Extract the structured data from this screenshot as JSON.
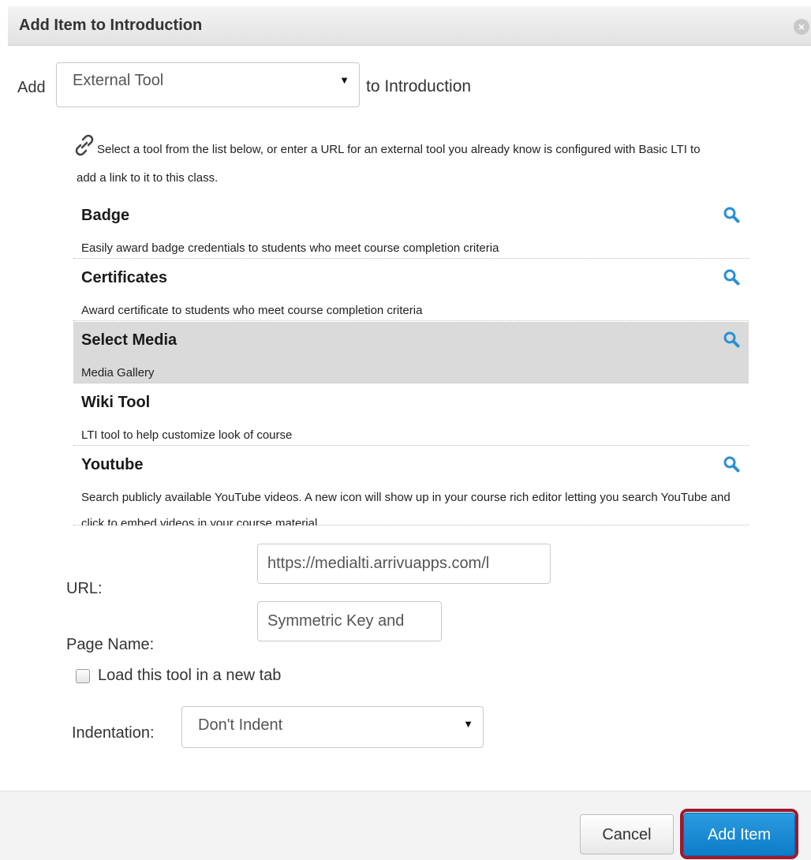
{
  "dialog": {
    "title": "Add Item to Introduction",
    "close_icon": "close-icon"
  },
  "add_row": {
    "prefix": "Add",
    "item_type": "External Tool",
    "suffix": "to Introduction"
  },
  "description": "Select a tool from the list below, or enter a URL for an external tool you already know is configured with Basic LTI to add a link to it to this class.",
  "tools": [
    {
      "name": "Badge",
      "description": "Easily award badge credentials to students who meet course completion criteria",
      "has_search": true,
      "selected": false
    },
    {
      "name": "Certificates",
      "description": "Award certificate to students who meet course completion criteria",
      "has_search": true,
      "selected": false
    },
    {
      "name": "Select Media",
      "description": "Media Gallery",
      "has_search": true,
      "selected": true
    },
    {
      "name": "Wiki Tool",
      "description": "LTI tool to help customize look of course",
      "has_search": false,
      "selected": false
    },
    {
      "name": "Youtube",
      "description": "Search publicly available YouTube videos. A new icon will show up in your course rich editor letting you search YouTube and click to embed videos in your course material.",
      "has_search": true,
      "selected": false
    }
  ],
  "form": {
    "url_label": "URL:",
    "url_value": "https://medialti.arrivuapps.com/l",
    "page_name_label": "Page Name:",
    "page_name_value": "Symmetric Key and",
    "new_tab_label": "Load this tool in a new tab",
    "new_tab_checked": false,
    "indentation_label": "Indentation:",
    "indentation_value": "Don't Indent"
  },
  "footer": {
    "cancel_label": "Cancel",
    "add_label": "Add Item"
  },
  "colors": {
    "primary": "#0e7cc8",
    "highlight_ring": "#9c1a2c",
    "search_icon": "#2a8fd8",
    "selected_row": "#dadada"
  }
}
